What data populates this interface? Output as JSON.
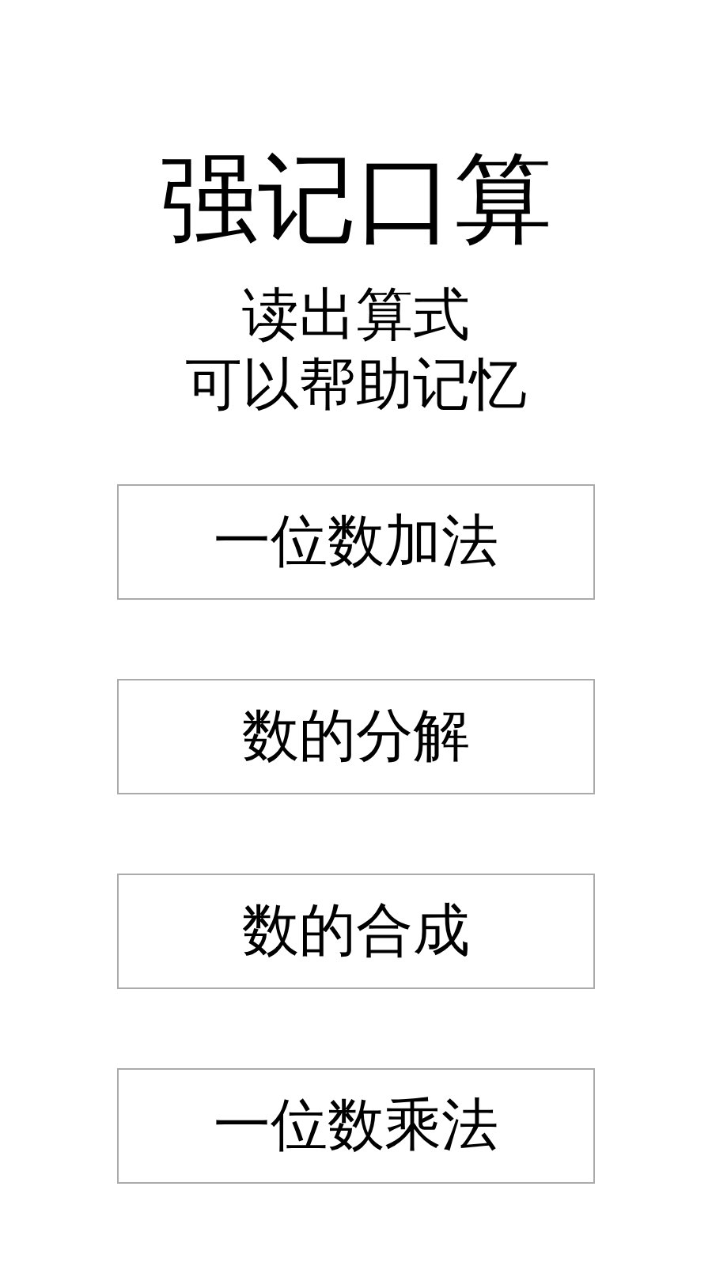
{
  "title": "强记口算",
  "subtitle": [
    "读出算式",
    "可以帮助记忆"
  ],
  "buttons": [
    "一位数加法",
    "数的分解",
    "数的合成",
    "一位数乘法"
  ]
}
